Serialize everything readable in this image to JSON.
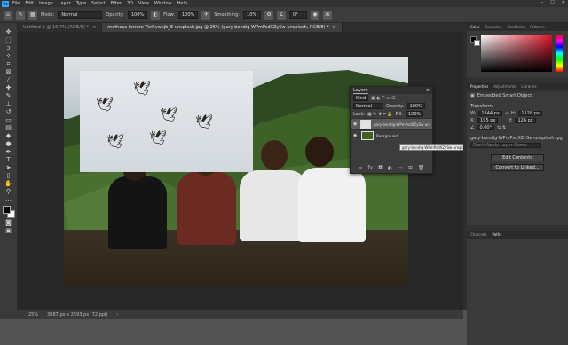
{
  "menu": {
    "items": [
      "File",
      "Edit",
      "Image",
      "Layer",
      "Type",
      "Select",
      "Filter",
      "3D",
      "View",
      "Window",
      "Help"
    ]
  },
  "options": {
    "mode_label": "Mode:",
    "mode": "Normal",
    "opacity_label": "Opacity:",
    "opacity": "100%",
    "flow_label": "Flow:",
    "flow": "100%",
    "smoothing_label": "Smoothing:",
    "smoothing": "10%",
    "angle": "0°"
  },
  "tabs": [
    {
      "label": "Untitled-1 @ 16.7% (RGB/8) *",
      "active": false
    },
    {
      "label": "matheus-ferrero-TkrRvwxjb_8-unsplash.jpg @ 25% (gary-bendig-WPmPsdXZySw-unsplash, RGB/8) *",
      "active": true
    }
  ],
  "layers": {
    "title": "Layers",
    "filter": "Kind",
    "blend": "Normal",
    "opacity_label": "Opacity:",
    "opacity": "100%",
    "lock_label": "Lock:",
    "fill_label": "Fill:",
    "fill": "100%",
    "items": [
      {
        "name": "gary-bendig-WPmPsdXZySw-unsplash",
        "selected": true
      },
      {
        "name": "Background",
        "selected": false
      }
    ]
  },
  "tooltip": "gary-bendig-WPmPsdXZySw-unsplash",
  "color_panel": {
    "tabs": [
      "Color",
      "Swatches",
      "Gradients",
      "Patterns"
    ]
  },
  "properties": {
    "tabs": [
      "Properties",
      "Adjustments",
      "Libraries"
    ],
    "type": "Embedded Smart Object",
    "section": "Transform",
    "w_label": "W:",
    "w": "1844 px",
    "h_label": "H:",
    "h": "1128 px",
    "x_label": "X:",
    "x": "195 px",
    "y_label": "Y:",
    "y": "126 px",
    "angle": "0.00°",
    "file": "gary-bendig-WPmPsdXZySw-unsplash.jpg",
    "comps": "Don't Apply Layer Comp",
    "edit_btn": "Edit Contents",
    "convert_btn": "Convert to Linked..."
  },
  "bottom_tabs": [
    "Channels",
    "Paths"
  ],
  "status": {
    "zoom": "25%",
    "doc": "3887 px x 2593 px (72 ppi)"
  },
  "colors": {
    "accent": "#31a8ff",
    "panel": "#3c3c3c"
  }
}
